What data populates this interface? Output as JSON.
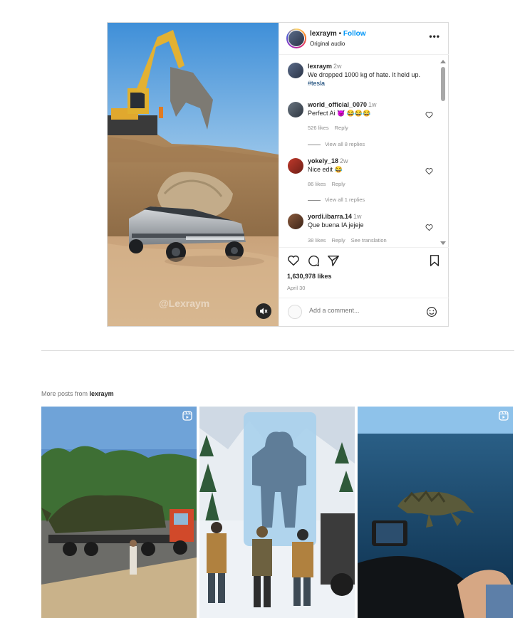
{
  "post": {
    "username": "lexraym",
    "follow_label": "Follow",
    "audio": "Original audio",
    "more_label": "•••",
    "watermark": "@Lexraym",
    "caption": {
      "username": "lexraym",
      "time": "2w",
      "text": "We dropped 1000 kg of hate. It held up.",
      "hashtag": "#tesla"
    },
    "comments": [
      {
        "username": "world_official_0070",
        "time": "1w",
        "text": "Perfect Ai 😈 😂😂😂",
        "likes": "526 likes",
        "reply": "Reply",
        "view_replies": "View all 8 replies"
      },
      {
        "username": "yokely_18",
        "time": "2w",
        "text": "Nice edit 😂",
        "likes": "86 likes",
        "reply": "Reply",
        "view_replies": "View all 1 replies"
      },
      {
        "username": "yordi.ibarra.14",
        "time": "1w",
        "text": "Que buena IA jejeje",
        "likes": "38 likes",
        "reply": "Reply",
        "translate": "See translation"
      }
    ],
    "likes_count": "1,630,978 likes",
    "date": "April 30",
    "add_comment_placeholder": "Add a comment..."
  },
  "more_posts": {
    "prefix": "More posts from",
    "username": "lexraym"
  },
  "colors": {
    "accent": "#0095f6",
    "text": "#262626",
    "muted": "#8e8e8e",
    "border": "#dbdbdb"
  },
  "icons": [
    "mute-icon",
    "heart-icon",
    "comment-icon",
    "share-icon",
    "bookmark-icon",
    "emoji-icon",
    "reel-icon",
    "more-icon"
  ]
}
